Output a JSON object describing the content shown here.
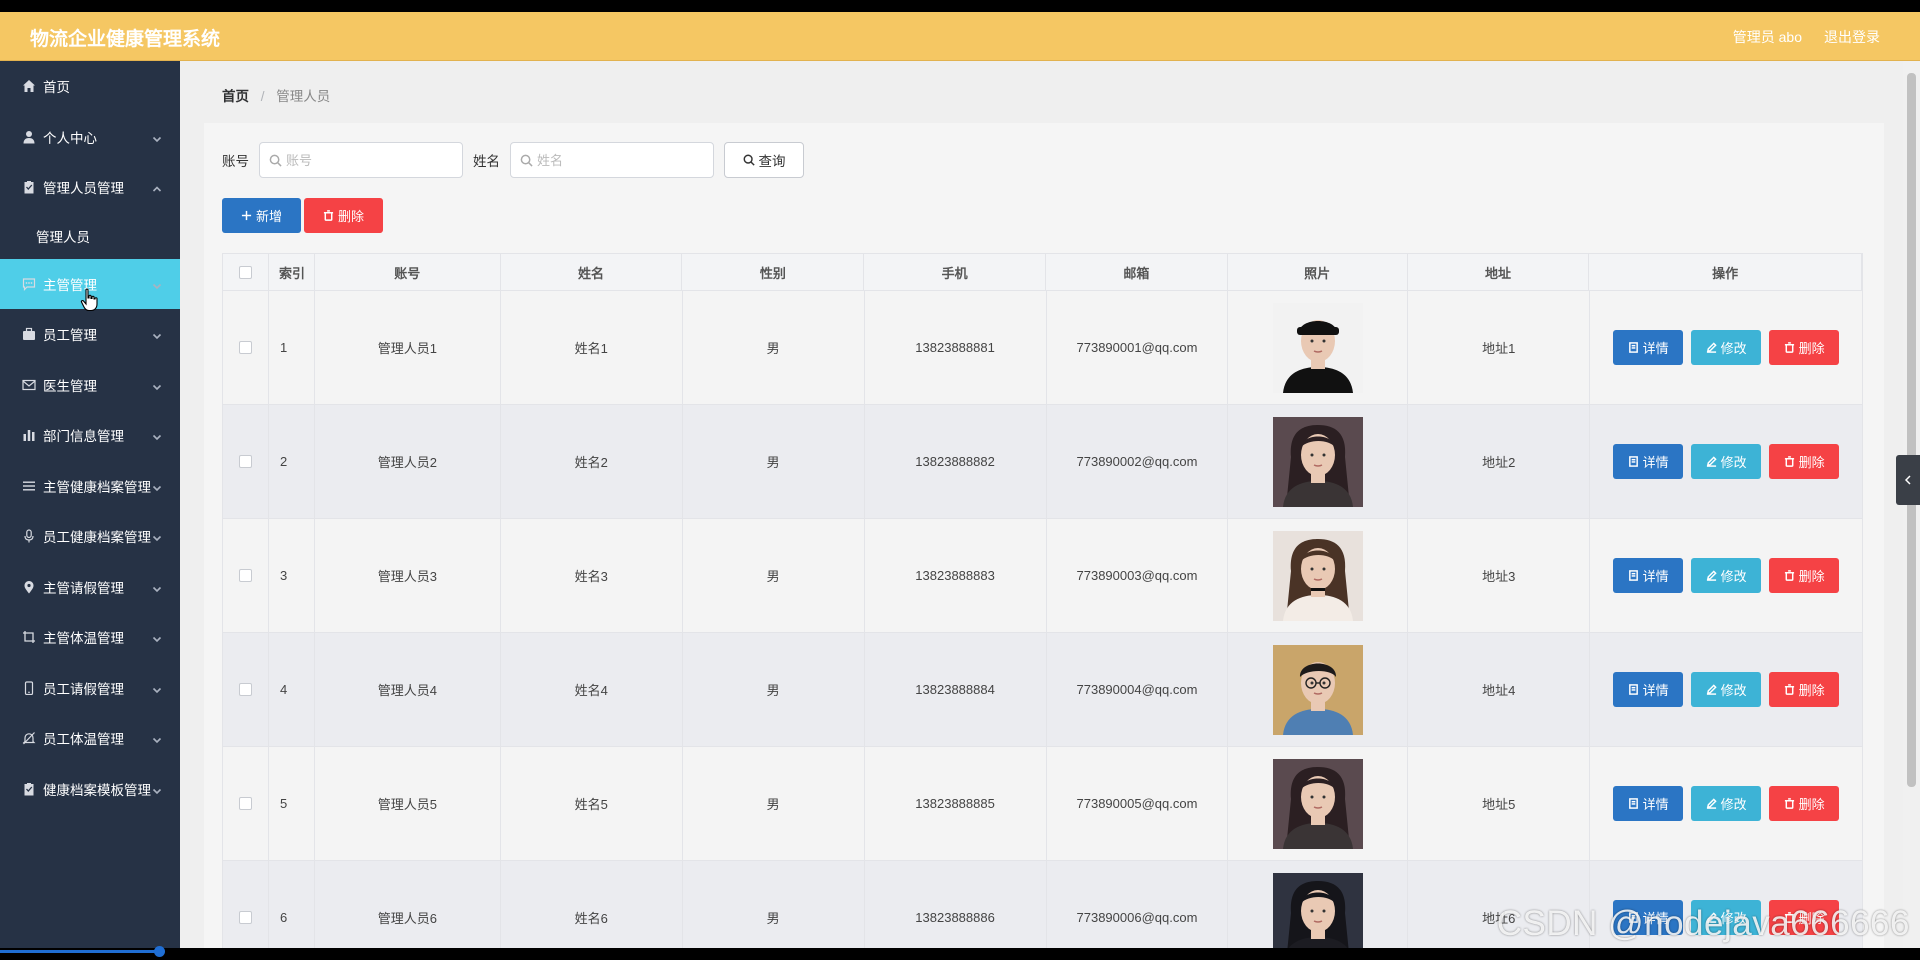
{
  "header": {
    "title": "物流企业健康管理系统",
    "user": "管理员 abo",
    "logout": "退出登录"
  },
  "sidebar": {
    "items": [
      {
        "label": "首页",
        "icon": "home-icon",
        "chevron": false
      },
      {
        "label": "个人中心",
        "icon": "user-icon",
        "chevron": true
      },
      {
        "label": "管理人员管理",
        "icon": "clipboard-icon",
        "chevron": true,
        "expanded": true
      },
      {
        "label": "管理人员",
        "icon": "",
        "chevron": false,
        "sub": true
      },
      {
        "label": "主管管理",
        "icon": "chat-icon",
        "chevron": true,
        "active": true
      },
      {
        "label": "员工管理",
        "icon": "briefcase-icon",
        "chevron": true
      },
      {
        "label": "医生管理",
        "icon": "mail-icon",
        "chevron": true
      },
      {
        "label": "部门信息管理",
        "icon": "bar-chart-icon",
        "chevron": true
      },
      {
        "label": "主管健康档案管理",
        "icon": "list-icon",
        "chevron": true
      },
      {
        "label": "员工健康档案管理",
        "icon": "microphone-icon",
        "chevron": true
      },
      {
        "label": "主管请假管理",
        "icon": "location-pin-icon",
        "chevron": true
      },
      {
        "label": "主管体温管理",
        "icon": "crop-icon",
        "chevron": true
      },
      {
        "label": "员工请假管理",
        "icon": "phone-icon",
        "chevron": true
      },
      {
        "label": "员工体温管理",
        "icon": "bell-off-icon",
        "chevron": true
      },
      {
        "label": "健康档案模板管理",
        "icon": "clipboard-icon",
        "chevron": true
      }
    ]
  },
  "breadcrumb": {
    "home": "首页",
    "separator": "/",
    "current": "管理人员"
  },
  "search": {
    "account_label": "账号",
    "account_placeholder": "账号",
    "name_label": "姓名",
    "name_placeholder": "姓名",
    "query_button": "查询"
  },
  "actions": {
    "add": "新增",
    "delete": "删除"
  },
  "table": {
    "columns": [
      "索引",
      "账号",
      "姓名",
      "性别",
      "手机",
      "邮箱",
      "照片",
      "地址",
      "操作"
    ],
    "row_buttons": {
      "detail": "详情",
      "edit": "修改",
      "delete": "删除"
    },
    "rows": [
      {
        "index": "1",
        "account": "管理人员1",
        "name": "姓名1",
        "gender": "男",
        "phone": "13823888881",
        "email": "773890001@qq.com",
        "address": "地址1",
        "photo": "portrait-man-black-cap"
      },
      {
        "index": "2",
        "account": "管理人员2",
        "name": "姓名2",
        "gender": "男",
        "phone": "13823888882",
        "email": "773890002@qq.com",
        "address": "地址2",
        "photo": "portrait-woman-scarf"
      },
      {
        "index": "3",
        "account": "管理人员3",
        "name": "姓名3",
        "gender": "男",
        "phone": "13823888883",
        "email": "773890003@qq.com",
        "address": "地址3",
        "photo": "portrait-woman-choker"
      },
      {
        "index": "4",
        "account": "管理人员4",
        "name": "姓名4",
        "gender": "男",
        "phone": "13823888884",
        "email": "773890004@qq.com",
        "address": "地址4",
        "photo": "portrait-man-denim"
      },
      {
        "index": "5",
        "account": "管理人员5",
        "name": "姓名5",
        "gender": "男",
        "phone": "13823888885",
        "email": "773890005@qq.com",
        "address": "地址5",
        "photo": "portrait-woman-scarf"
      },
      {
        "index": "6",
        "account": "管理人员6",
        "name": "姓名6",
        "gender": "男",
        "phone": "13823888886",
        "email": "773890006@qq.com",
        "address": "地址6",
        "photo": "portrait-woman-dark"
      }
    ]
  },
  "watermark": "CSDN @nodejava666666",
  "colors": {
    "header": "#f5c763",
    "sidebar": "#263245",
    "sidebar_active": "#4fcee8",
    "primary": "#2b75c4",
    "info": "#3db3d6",
    "danger": "#f54245"
  }
}
